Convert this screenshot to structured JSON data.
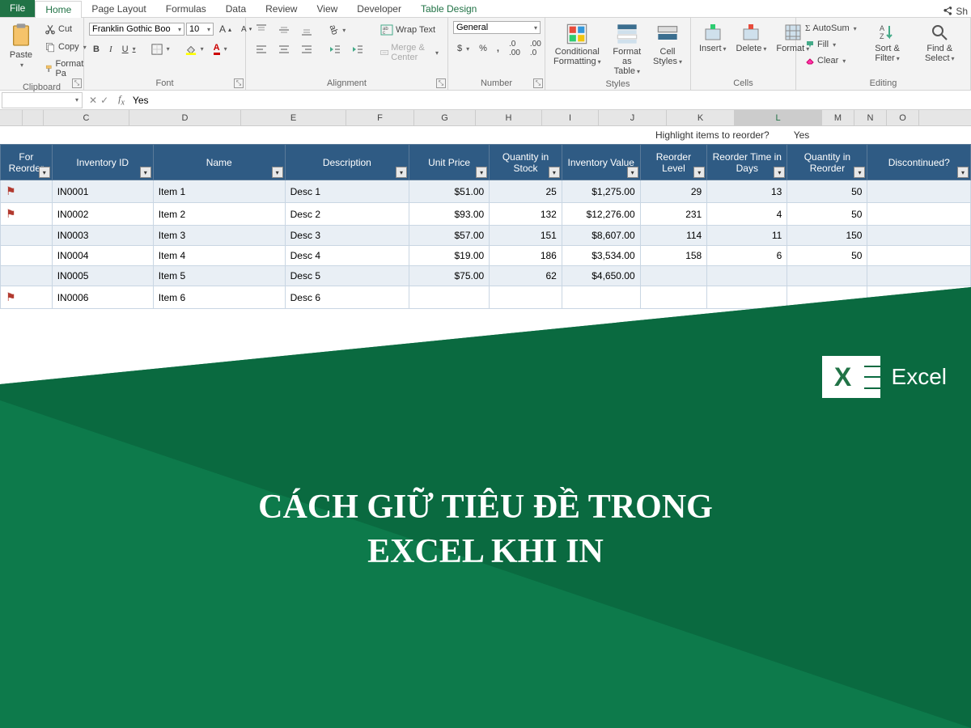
{
  "tabs": {
    "file": "File",
    "home": "Home",
    "page_layout": "Page Layout",
    "formulas": "Formulas",
    "data": "Data",
    "review": "Review",
    "view": "View",
    "developer": "Developer",
    "table_design": "Table Design",
    "share": "Sh"
  },
  "clipboard": {
    "paste": "Paste",
    "cut": "Cut",
    "copy": "Copy",
    "format_painter": "Format Pa",
    "label": "Clipboard"
  },
  "font": {
    "name": "Franklin Gothic Boo",
    "size": "10",
    "bold": "B",
    "italic": "I",
    "underline": "U",
    "label": "Font"
  },
  "alignment": {
    "wrap": "Wrap Text",
    "merge": "Merge & Center",
    "label": "Alignment"
  },
  "number": {
    "format": "General",
    "label": "Number"
  },
  "styles": {
    "cond": "Conditional Formatting",
    "table": "Format as Table",
    "cell": "Cell Styles",
    "label": "Styles"
  },
  "cells": {
    "insert": "Insert",
    "delete": "Delete",
    "format": "Format",
    "label": "Cells"
  },
  "editing": {
    "autosum": "AutoSum",
    "fill": "Fill",
    "clear": "Clear",
    "sort": "Sort & Filter",
    "find": "Find & Select",
    "label": "Editing"
  },
  "formula_bar": {
    "cell_ref": "",
    "value": "Yes"
  },
  "columns": [
    "C",
    "D",
    "E",
    "F",
    "G",
    "H",
    "I",
    "J",
    "K",
    "L",
    "M",
    "N",
    "O"
  ],
  "highlight": {
    "label": "Highlight items to reorder?",
    "value": "Yes"
  },
  "headers": [
    "For Reorder",
    "Inventory ID",
    "Name",
    "Description",
    "Unit Price",
    "Quantity in Stock",
    "Inventory Value",
    "Reorder Level",
    "Reorder Time in Days",
    "Quantity in Reorder",
    "Discontinued?"
  ],
  "rows": [
    {
      "flag": true,
      "id": "IN0001",
      "name": "Item 1",
      "desc": "Desc 1",
      "price": "$51.00",
      "qty": "25",
      "val": "$1,275.00",
      "reorder": "29",
      "days": "13",
      "reqty": "50",
      "disc": ""
    },
    {
      "flag": true,
      "id": "IN0002",
      "name": "Item 2",
      "desc": "Desc 2",
      "price": "$93.00",
      "qty": "132",
      "val": "$12,276.00",
      "reorder": "231",
      "days": "4",
      "reqty": "50",
      "disc": ""
    },
    {
      "flag": false,
      "id": "IN0003",
      "name": "Item 3",
      "desc": "Desc 3",
      "price": "$57.00",
      "qty": "151",
      "val": "$8,607.00",
      "reorder": "114",
      "days": "11",
      "reqty": "150",
      "disc": ""
    },
    {
      "flag": false,
      "id": "IN0004",
      "name": "Item 4",
      "desc": "Desc 4",
      "price": "$19.00",
      "qty": "186",
      "val": "$3,534.00",
      "reorder": "158",
      "days": "6",
      "reqty": "50",
      "disc": ""
    },
    {
      "flag": false,
      "id": "IN0005",
      "name": "Item 5",
      "desc": "Desc 5",
      "price": "$75.00",
      "qty": "62",
      "val": "$4,650.00",
      "reorder": "",
      "days": "",
      "reqty": "",
      "disc": ""
    },
    {
      "flag": true,
      "id": "IN0006",
      "name": "Item 6",
      "desc": "Desc 6",
      "price": "",
      "qty": "",
      "val": "",
      "reorder": "",
      "days": "",
      "reqty": "",
      "disc": ""
    }
  ],
  "overlay": {
    "brand": "Excel",
    "title_line1": "CÁCH GIỮ TIÊU ĐỀ TRONG",
    "title_line2": "EXCEL KHI IN"
  },
  "col_widths": {
    "reorder": 54,
    "id": 106,
    "name": 138,
    "desc": 130,
    "price": 84,
    "qty": 76,
    "val": 82,
    "rlevel": 70,
    "rdays": 84,
    "reqty": 84,
    "disc": 108
  }
}
